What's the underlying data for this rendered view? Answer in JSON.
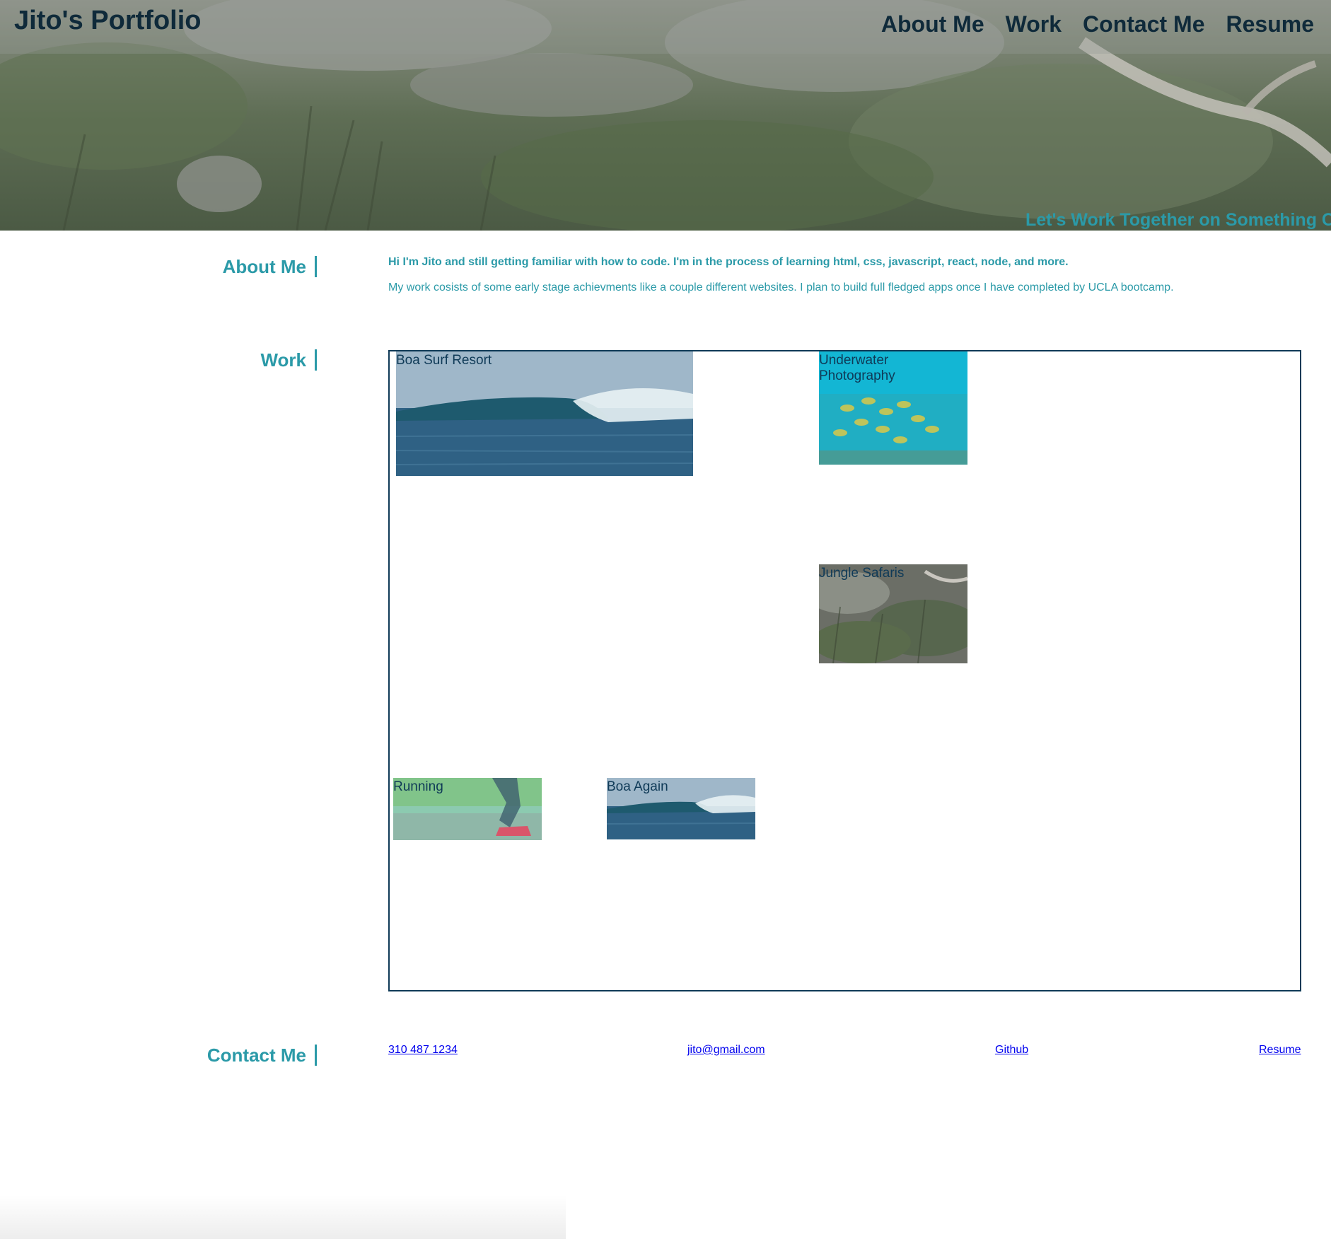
{
  "header": {
    "site_title": "Jito's Portfolio",
    "nav": [
      "About Me",
      "Work",
      "Contact Me",
      "Resume"
    ],
    "tagline": "Let's Work Together on Something Co"
  },
  "about": {
    "heading": "About Me",
    "intro": "Hi I'm Jito and still getting familiar with how to code. I'm in the process of learning html, css, javascript, react, node, and more.",
    "body": "My work cosists of some early stage achievments like a couple different websites. I plan to build full fledged apps once I have completed by UCLA bootcamp."
  },
  "work": {
    "heading": "Work",
    "items": [
      {
        "title": "Boa Surf Resort",
        "image": "ocean-wave"
      },
      {
        "title": "Underwater Photography",
        "image": "fish-school"
      },
      {
        "title": "Jungle Safaris",
        "image": "jungle-foliage"
      },
      {
        "title": "Running",
        "image": "runner-shoe"
      },
      {
        "title": "Boa Again",
        "image": "ocean-wave"
      }
    ]
  },
  "contact": {
    "heading": "Contact Me",
    "links": [
      "310 487 1234",
      "jito@gmail.com",
      "Github",
      "Resume"
    ]
  },
  "colors": {
    "accent": "#2b9aa8",
    "dark": "#0f2a3a",
    "link": "#0000ee",
    "border": "#0f3a57"
  }
}
